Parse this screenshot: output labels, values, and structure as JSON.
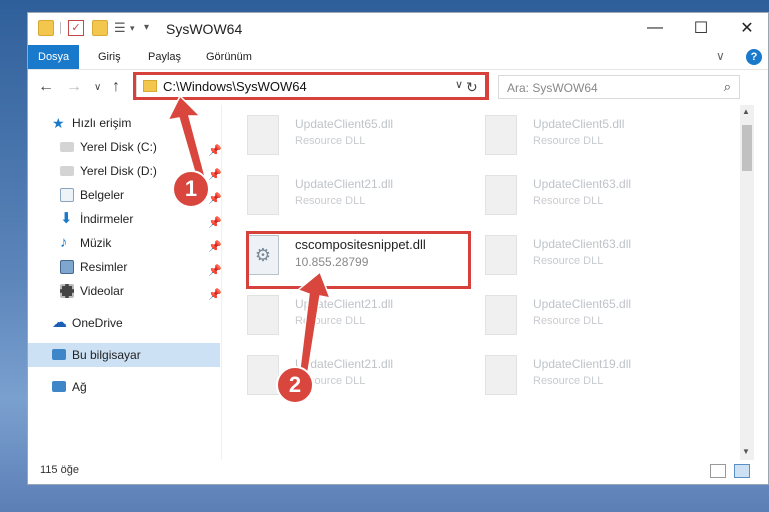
{
  "window": {
    "title": "SysWOW64",
    "minimize": "—",
    "maximize": "☐",
    "close": "✕"
  },
  "ribbon": {
    "tabs": [
      "Dosya",
      "Giriş",
      "Paylaş",
      "Görünüm"
    ],
    "expand": "∨",
    "help": "?"
  },
  "nav": {
    "back": "←",
    "forward": "→",
    "recent": "∨",
    "up": "↑",
    "address": "C:\\Windows\\SysWOW64",
    "address_dropdown": "∨",
    "refresh": "↻",
    "search_placeholder": "Ara: SysWOW64",
    "search_icon": "⌕"
  },
  "sidebar": {
    "quick_access": "Hızlı erişim",
    "items": [
      {
        "label": "Yerel Disk (C:)",
        "icon": "drive-icon",
        "pinned": true
      },
      {
        "label": "Yerel Disk (D:)",
        "icon": "drive-icon",
        "pinned": true
      },
      {
        "label": "Belgeler",
        "icon": "documents-icon",
        "pinned": true
      },
      {
        "label": "İndirmeler",
        "icon": "download-icon",
        "pinned": true
      },
      {
        "label": "Müzik",
        "icon": "music-icon",
        "pinned": true
      },
      {
        "label": "Resimler",
        "icon": "pictures-icon",
        "pinned": true
      },
      {
        "label": "Videolar",
        "icon": "video-icon",
        "pinned": true
      }
    ],
    "onedrive": "OneDrive",
    "this_pc": "Bu bilgisayar",
    "network": "Ağ"
  },
  "files": [
    {
      "name": "UpdateClient65.dll",
      "type": "Resource DLL"
    },
    {
      "name": "UpdateClient5.dll",
      "type": "Resource DLL"
    },
    {
      "name": "UpdateClient21.dll",
      "type": "Resource DLL"
    },
    {
      "name": "UpdateClient63.dll",
      "type": "Resource DLL"
    },
    {
      "name": "cscompositesnippet.dll",
      "type": "10.855.28799"
    },
    {
      "name": "UpdateClient63.dll",
      "type": "Resource DLL"
    },
    {
      "name": "UpdateClient21.dll",
      "type": "Resource DLL"
    },
    {
      "name": "UpdateClient65.dll",
      "type": "Resource DLL"
    },
    {
      "name": "UpdateClient21.dll",
      "type": "Resource DLL"
    },
    {
      "name": "UpdateClient19.dll",
      "type": "Resource DLL"
    }
  ],
  "status": {
    "count": "115 öğe"
  },
  "annotations": {
    "step1": "1",
    "step2": "2"
  },
  "colors": {
    "accent": "#1979ca",
    "highlight": "#d6423b",
    "selected": "#cde1f4"
  }
}
